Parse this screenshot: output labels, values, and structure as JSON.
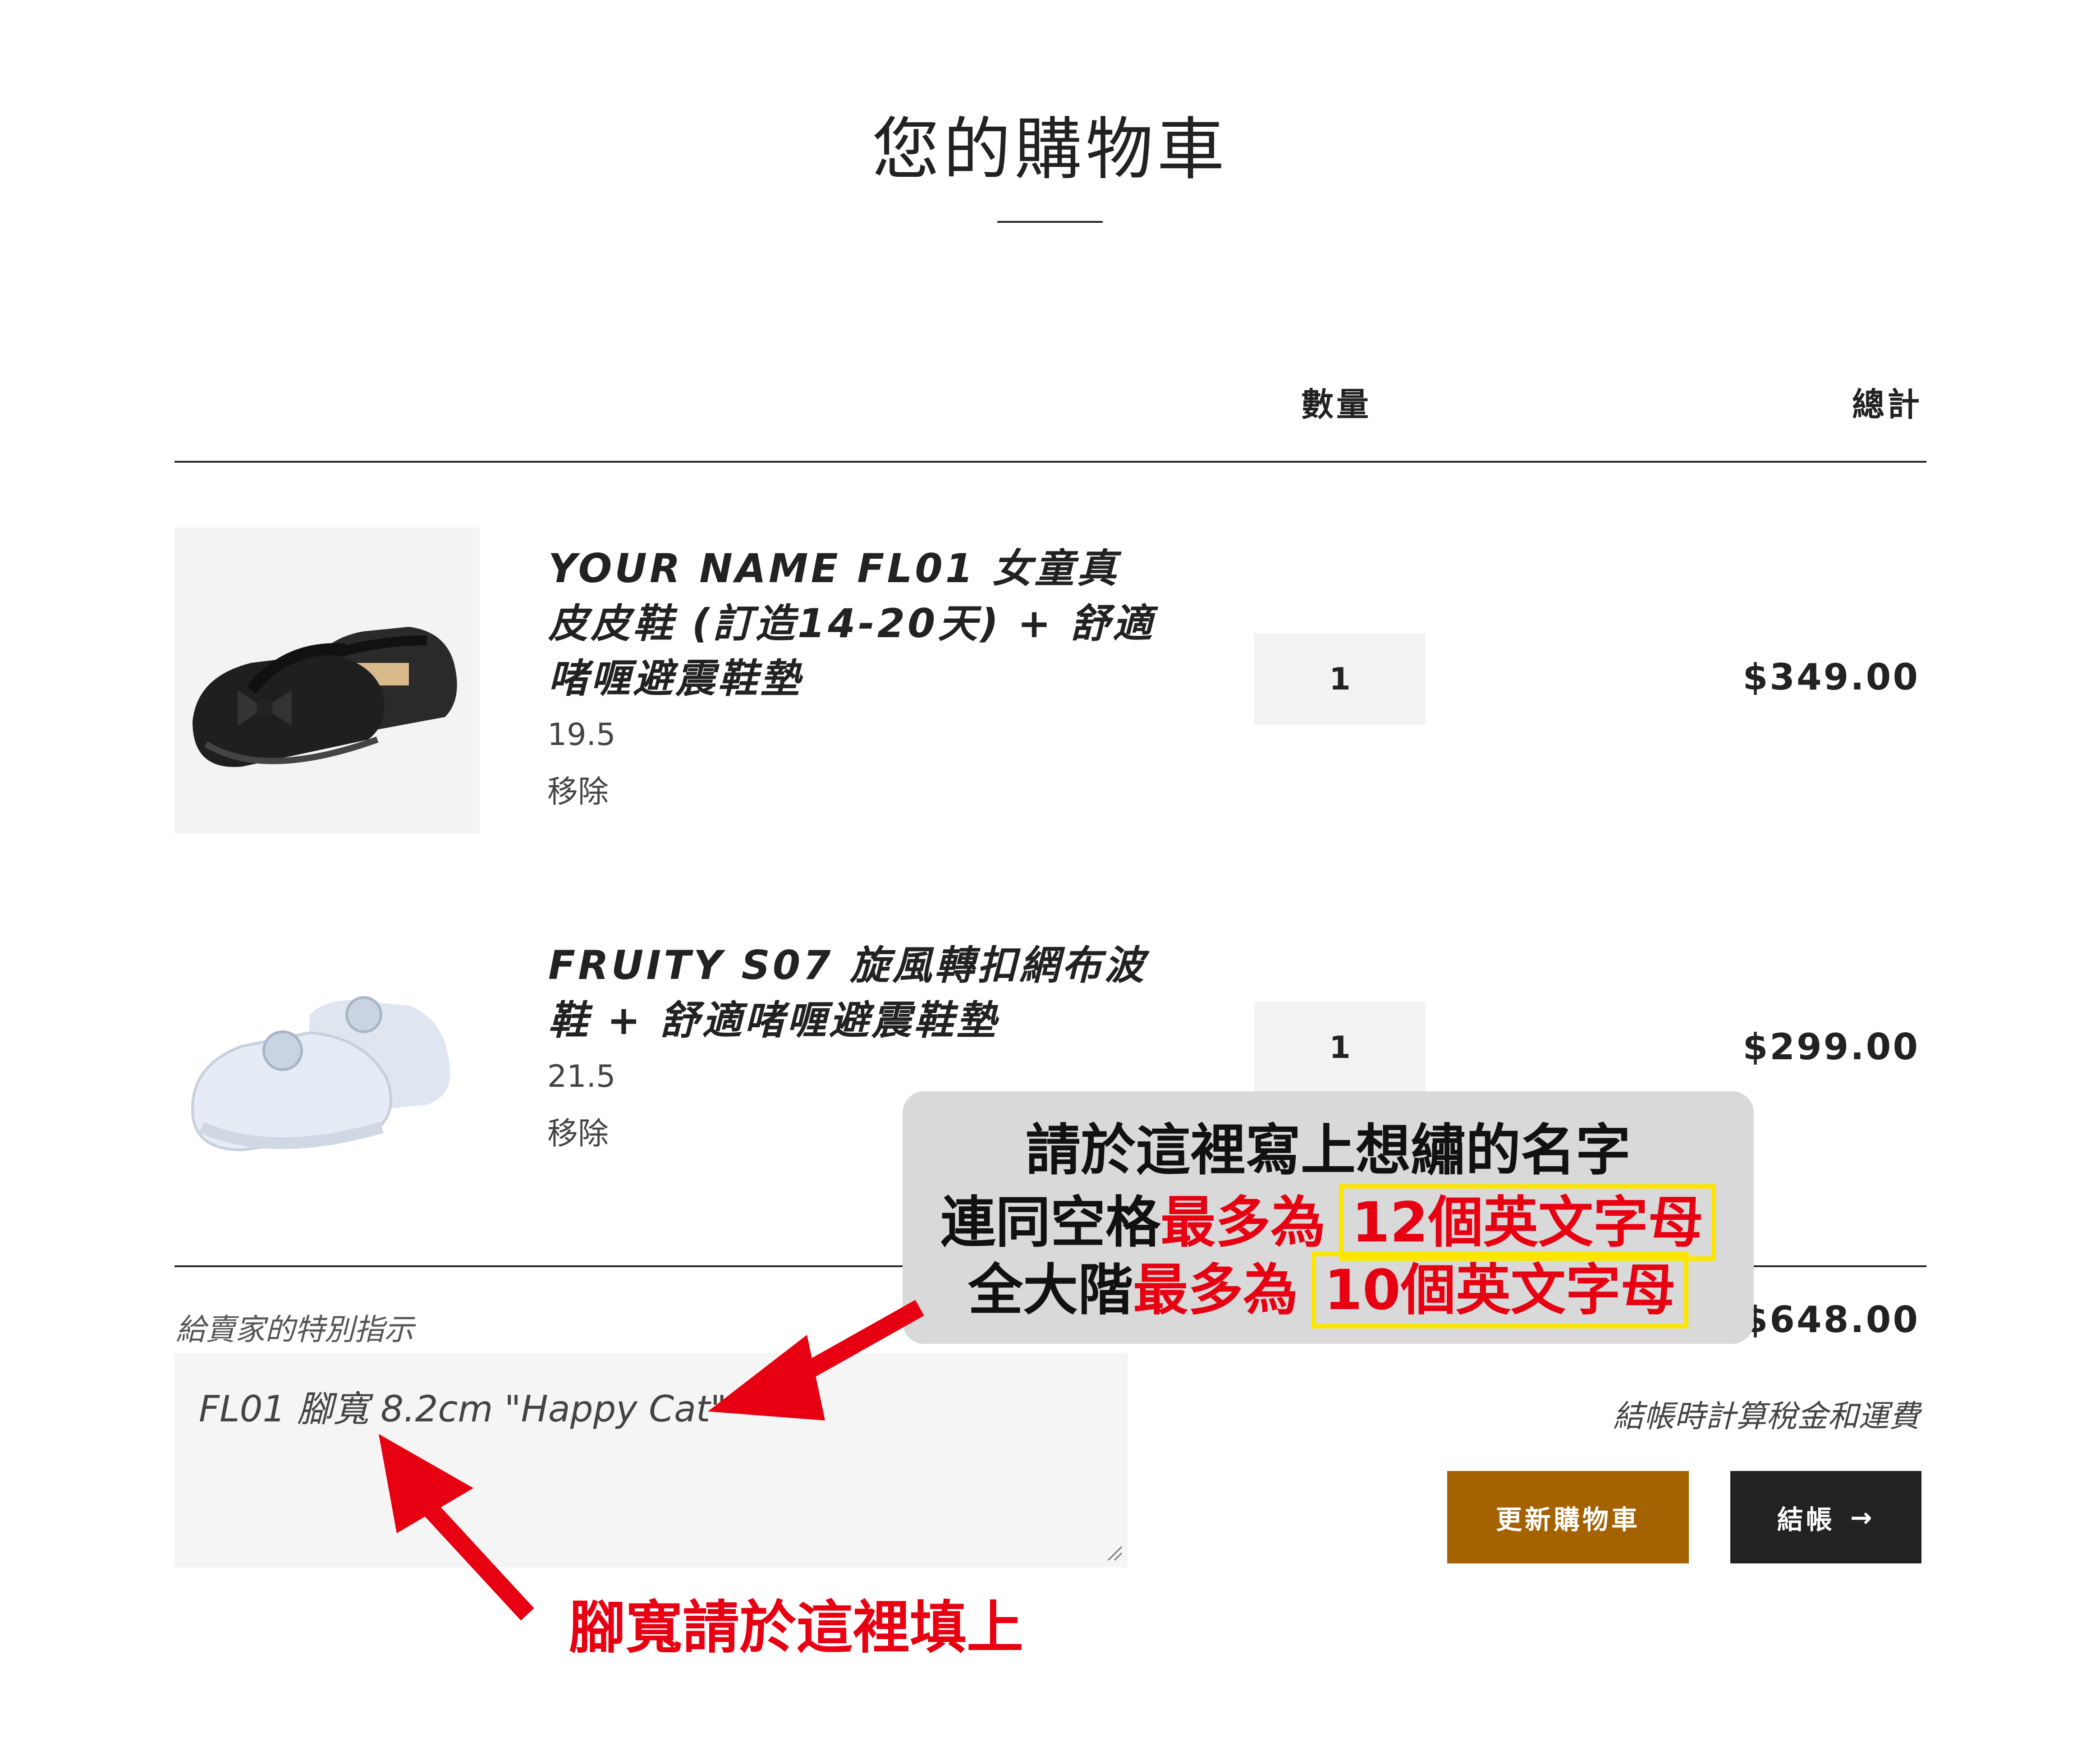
{
  "page": {
    "title": "您的購物車"
  },
  "table_header": {
    "quantity": "數量",
    "total": "總計"
  },
  "items": [
    {
      "title_lines": [
        "YOUR NAME FL01 女童真",
        "皮皮鞋 (訂造14-20天) + 舒適",
        "啫喱避震鞋墊"
      ],
      "variant": "19.5",
      "remove": "移除",
      "quantity": "1",
      "price": "$349.00",
      "image_icon": "black-mary-jane-shoe-icon"
    },
    {
      "title_lines": [
        "FRUITY S07 旋風轉扣網布波",
        "鞋 + 舒適啫喱避震鞋墊"
      ],
      "variant": "21.5",
      "remove": "移除",
      "quantity": "1",
      "price": "$299.00",
      "image_icon": "white-sneaker-icon"
    }
  ],
  "notes": {
    "label": "給賣家的特別指示",
    "value": "FL01 腳寬 8.2cm \"Happy Cat\""
  },
  "summary": {
    "subtotal": "$648.00",
    "tax_note": "結帳時計算稅金和運費",
    "update_button": "更新購物車",
    "checkout_button": "結帳",
    "checkout_arrow": "→"
  },
  "callout": {
    "line1": "請於這裡寫上想繡的名字",
    "line2_prefix": "連同空格",
    "line2_red": "最多為",
    "line2_box": "12個英文字母",
    "line3_prefix": "全大階",
    "line3_red": "最多為",
    "line3_box": "10個英文字母"
  },
  "annotation_bottom": "腳寬請於這裡填上",
  "colors": {
    "accent_button": "#a46200",
    "dark_button": "#222222",
    "annotation_red": "#e60012",
    "highlight_yellow": "#ffe600"
  }
}
